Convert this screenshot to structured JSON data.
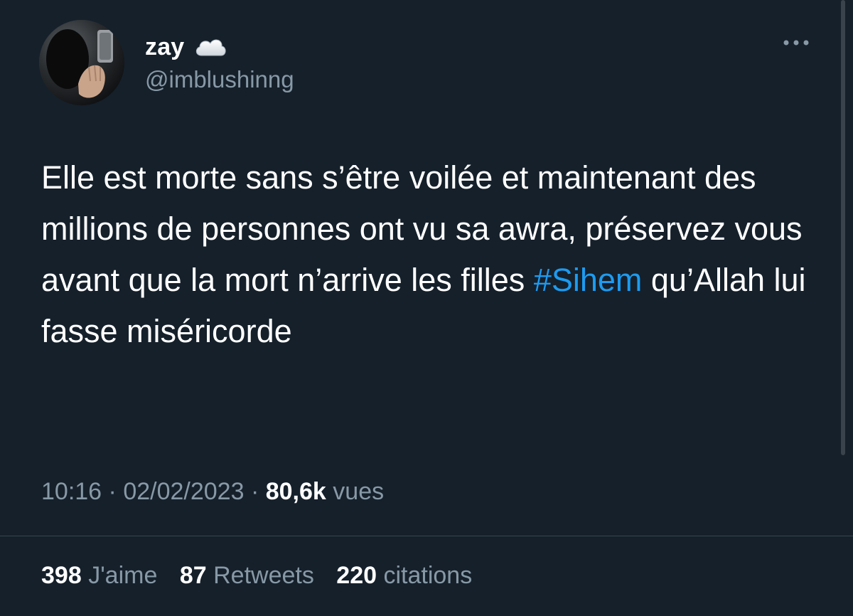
{
  "author": {
    "display_name": "zay",
    "handle": "@imblushinng",
    "name_emoji_icon": "cloud-icon",
    "avatar_icon": "avatar-photo"
  },
  "menu": {
    "icon": "more-horizontal-icon"
  },
  "tweet": {
    "text_before": "Elle est morte sans s’être voilée et maintenant des millions de personnes ont vu sa awra, préservez vous avant que la mort n’arrive les filles ",
    "hashtag": "#Sihem",
    "text_after": " qu’Allah lui fasse miséricorde"
  },
  "meta": {
    "time": "10:16",
    "separator": "·",
    "date": "02/02/2023",
    "views_count": "80,6k",
    "views_label": "vues"
  },
  "stats": {
    "likes_count": "398",
    "likes_label": "J'aime",
    "retweets_count": "87",
    "retweets_label": "Retweets",
    "quotes_count": "220",
    "quotes_label": "citations"
  },
  "colors": {
    "background": "#15202b",
    "text": "#ffffff",
    "muted": "#8899a6",
    "link": "#1d9bf0",
    "divider": "#38444d"
  }
}
